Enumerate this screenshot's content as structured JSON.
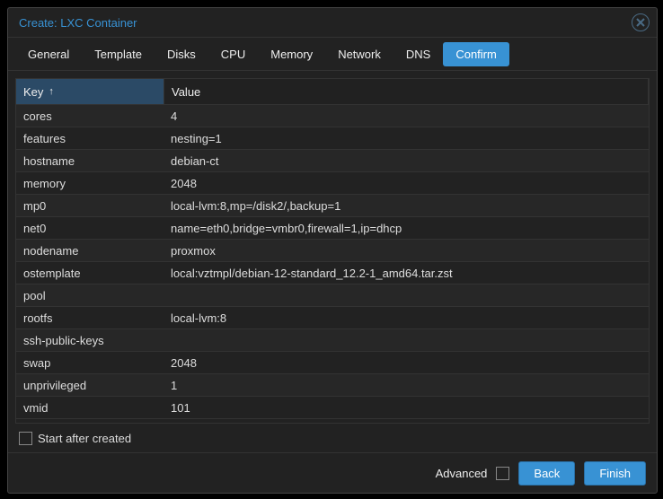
{
  "window": {
    "title": "Create: LXC Container"
  },
  "tabs": [
    {
      "label": "General",
      "active": false
    },
    {
      "label": "Template",
      "active": false
    },
    {
      "label": "Disks",
      "active": false
    },
    {
      "label": "CPU",
      "active": false
    },
    {
      "label": "Memory",
      "active": false
    },
    {
      "label": "Network",
      "active": false
    },
    {
      "label": "DNS",
      "active": false
    },
    {
      "label": "Confirm",
      "active": true
    }
  ],
  "table": {
    "columns": {
      "key": "Key",
      "value": "Value",
      "sort_arrow": "↑"
    },
    "rows": [
      {
        "key": "cores",
        "value": "4"
      },
      {
        "key": "features",
        "value": "nesting=1"
      },
      {
        "key": "hostname",
        "value": "debian-ct"
      },
      {
        "key": "memory",
        "value": "2048"
      },
      {
        "key": "mp0",
        "value": "local-lvm:8,mp=/disk2/,backup=1"
      },
      {
        "key": "net0",
        "value": "name=eth0,bridge=vmbr0,firewall=1,ip=dhcp"
      },
      {
        "key": "nodename",
        "value": "proxmox"
      },
      {
        "key": "ostemplate",
        "value": "local:vztmpl/debian-12-standard_12.2-1_amd64.tar.zst"
      },
      {
        "key": "pool",
        "value": ""
      },
      {
        "key": "rootfs",
        "value": "local-lvm:8"
      },
      {
        "key": "ssh-public-keys",
        "value": ""
      },
      {
        "key": "swap",
        "value": "2048"
      },
      {
        "key": "unprivileged",
        "value": "1"
      },
      {
        "key": "vmid",
        "value": "101"
      }
    ]
  },
  "start_after_label": "Start after created",
  "footer": {
    "advanced_label": "Advanced",
    "back_label": "Back",
    "finish_label": "Finish"
  }
}
